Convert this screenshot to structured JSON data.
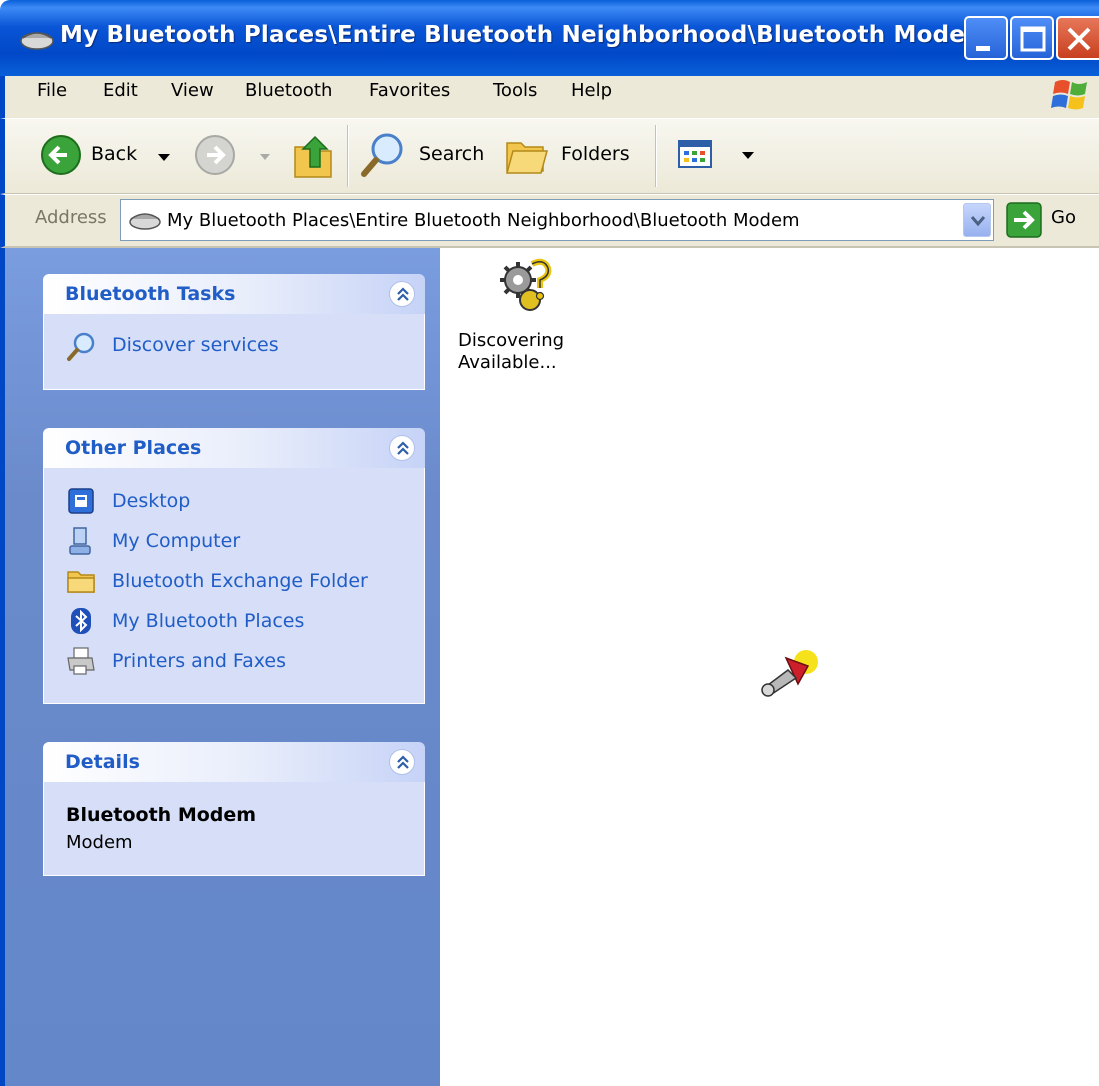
{
  "window": {
    "title": "My Bluetooth Places\\Entire Bluetooth Neighborhood\\Bluetooth Modem"
  },
  "menu": [
    "File",
    "Edit",
    "View",
    "Bluetooth",
    "Favorites",
    "Tools",
    "Help"
  ],
  "toolbar": {
    "back_label": "Back",
    "search_label": "Search",
    "folders_label": "Folders"
  },
  "address": {
    "label": "Address",
    "value": "My Bluetooth Places\\Entire Bluetooth Neighborhood\\Bluetooth Modem",
    "go_label": "Go"
  },
  "tasks_panel": {
    "title": "Bluetooth Tasks",
    "items": [
      {
        "label": "Discover services",
        "icon": "magnifier-icon"
      }
    ]
  },
  "places_panel": {
    "title": "Other Places",
    "items": [
      {
        "label": "Desktop",
        "icon": "desktop-icon"
      },
      {
        "label": "My Computer",
        "icon": "computer-icon"
      },
      {
        "label": "Bluetooth Exchange Folder",
        "icon": "folder-icon"
      },
      {
        "label": "My Bluetooth Places",
        "icon": "bluetooth-icon"
      },
      {
        "label": "Printers and Faxes",
        "icon": "printer-icon"
      }
    ]
  },
  "details_panel": {
    "title": "Details",
    "name": "Bluetooth Modem",
    "type": "Modem"
  },
  "content": {
    "item_line1": "Discovering",
    "item_line2": "Available..."
  },
  "colors": {
    "titlebar": "#0a56d6",
    "taskpane": "#6387c9",
    "panel_body": "#d6dff7",
    "link": "#215dc6"
  }
}
